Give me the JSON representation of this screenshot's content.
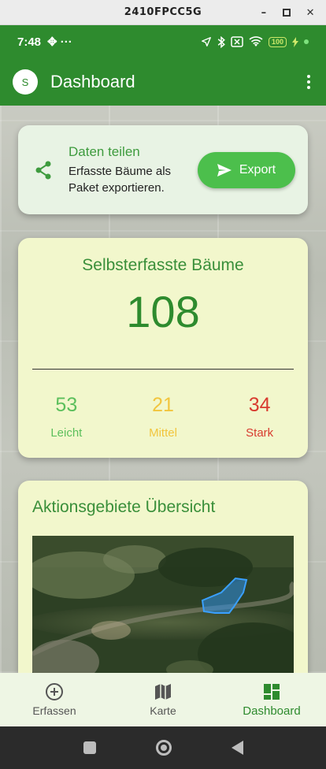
{
  "window": {
    "title": "2410FPCC5G"
  },
  "status_bar": {
    "time": "7:48",
    "extra": "✥ ···",
    "battery": "100"
  },
  "app_bar": {
    "avatar_letter": "S",
    "title": "Dashboard"
  },
  "share_card": {
    "title": "Daten teilen",
    "description": "Erfasste Bäume als Paket exportieren.",
    "button_label": "Export"
  },
  "stats_card": {
    "title": "Selbsterfasste Bäume",
    "total": "108",
    "categories": [
      {
        "value": "53",
        "label": "Leicht",
        "color": "#5cbf5c"
      },
      {
        "value": "21",
        "label": "Mittel",
        "color": "#f2c53d"
      },
      {
        "value": "34",
        "label": "Stark",
        "color": "#d83b2f"
      }
    ]
  },
  "map_card": {
    "title": "Aktionsgebiete Übersicht"
  },
  "bottom_nav": {
    "items": [
      {
        "label": "Erfassen",
        "icon": "add-circle-icon"
      },
      {
        "label": "Karte",
        "icon": "map-icon"
      },
      {
        "label": "Dashboard",
        "icon": "dashboard-icon"
      }
    ],
    "active": "Dashboard"
  },
  "colors": {
    "primary": "#2e8b2e",
    "accent": "#4cbf4c"
  }
}
